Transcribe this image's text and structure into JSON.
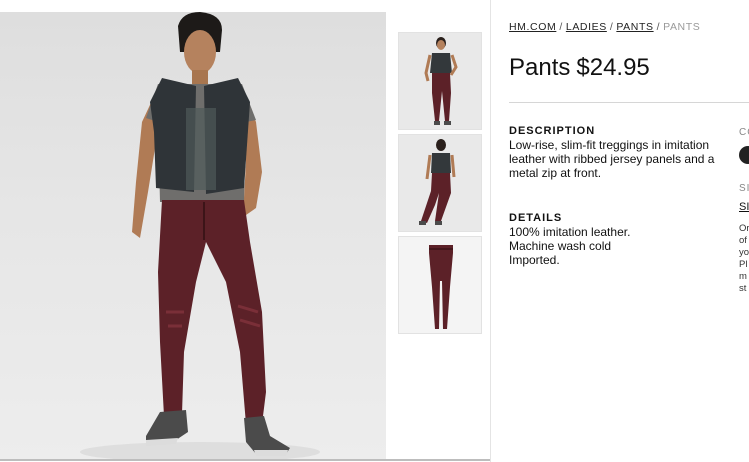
{
  "breadcrumb": [
    {
      "label": "HM.COM",
      "link": true
    },
    {
      "label": "LADIES",
      "link": true
    },
    {
      "label": "PANTS",
      "link": true
    },
    {
      "label": "PANTS",
      "link": false
    }
  ],
  "breadcrumb_separator": "/",
  "product": {
    "name": "Pants",
    "price": "$24.95"
  },
  "description": {
    "heading": "DESCRIPTION",
    "text": "Low-rise, slim-fit treggings in imitation leather with ribbed jersey panels and a metal zip at front."
  },
  "details": {
    "heading": "DETAILS",
    "lines": [
      "100% imitation leather.",
      "Machine wash cold",
      "Imported."
    ]
  },
  "side_panel": {
    "color_label": "CO",
    "size_label": "SI",
    "size_link": "SI",
    "note_lines": [
      "Or",
      "of",
      "yo",
      "Pl",
      "m",
      "st"
    ]
  },
  "colors": {
    "leather": "#5c2128",
    "swatch": "#222222",
    "accent_text": "#111111"
  },
  "images": {
    "main": "model-front-photo",
    "thumbnails": [
      "model-front-thumb",
      "model-back-thumb",
      "pants-flat-thumb"
    ]
  }
}
